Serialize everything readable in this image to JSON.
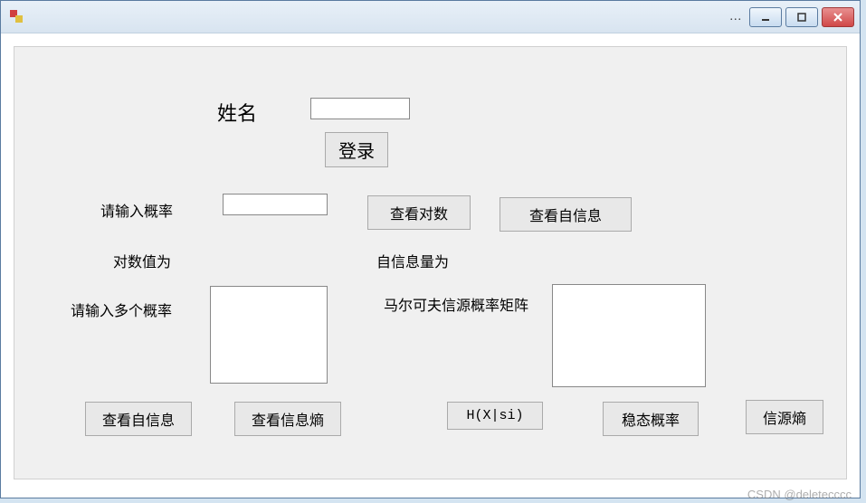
{
  "titlebar": {
    "dots": "..."
  },
  "login": {
    "name_label": "姓名",
    "name_value": "",
    "login_button": "登录"
  },
  "single": {
    "input_label": "请输入概率",
    "input_value": "",
    "view_log_button": "查看对数",
    "view_selfinfo_button": "查看自信息",
    "log_value_label": "对数值为",
    "selfinfo_amount_label": "自信息量为"
  },
  "multi": {
    "input_label": "请输入多个概率",
    "input_value": "",
    "markov_label": "马尔可夫信源概率矩阵",
    "markov_value": "",
    "view_selfinfo_button": "查看自信息",
    "view_entropy_button": "查看信息熵",
    "hxsi_button": "H(X|si)",
    "steady_prob_button": "稳态概率",
    "source_entropy_button": "信源熵"
  },
  "watermark": "CSDN @deletecccc"
}
